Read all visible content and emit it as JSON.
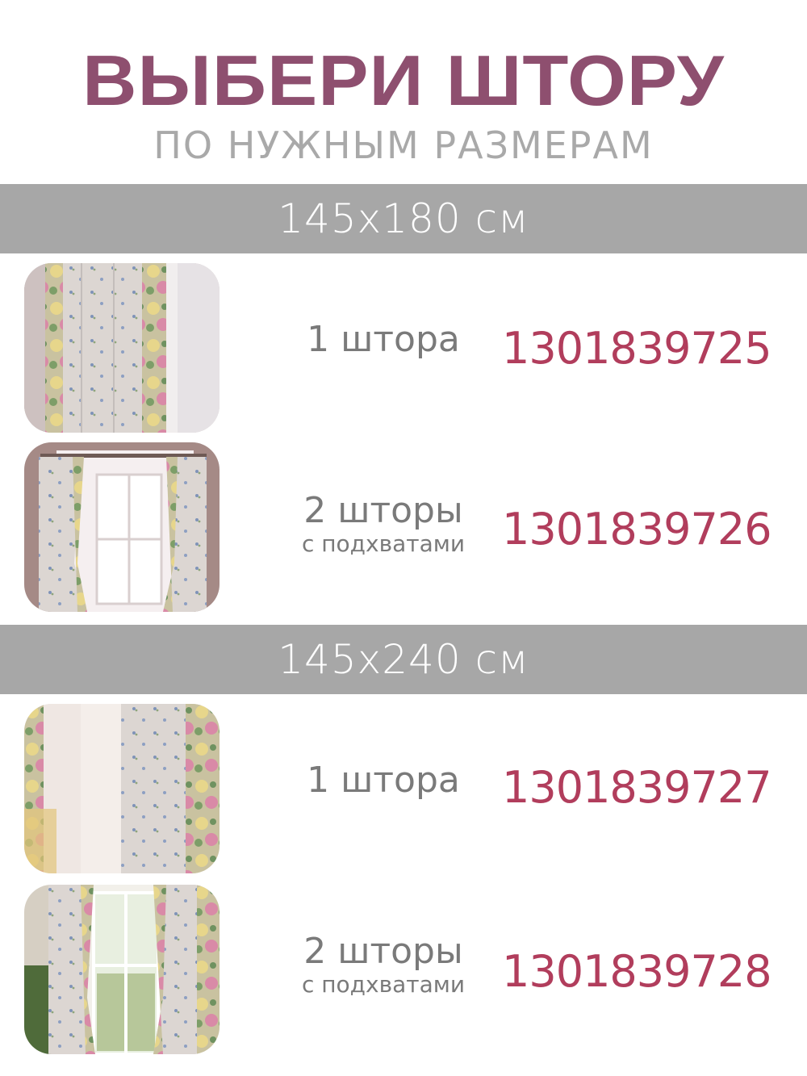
{
  "header": {
    "title": "ВЫБЕРИ ШТОРУ",
    "subtitle": "ПО НУЖНЫМ РАЗМЕРАМ"
  },
  "colors": {
    "title": "#8e4f6f",
    "subtitle": "#a9a9a9",
    "band": "#a7a7a7",
    "code": "#b13d5c",
    "label": "#7a7a7a"
  },
  "sections": [
    {
      "size": "145x180 см",
      "items": [
        {
          "label": "1 штора",
          "sublabel": "",
          "code": "1301839725",
          "icon": "single-curtain-photo"
        },
        {
          "label": "2 шторы",
          "sublabel": "с подхватами",
          "code": "1301839726",
          "icon": "pair-curtains-photo"
        }
      ]
    },
    {
      "size": "145x240 см",
      "items": [
        {
          "label": "1 штора",
          "sublabel": "",
          "code": "1301839727",
          "icon": "single-curtain-photo"
        },
        {
          "label": "2 шторы",
          "sublabel": "с подхватами",
          "code": "1301839728",
          "icon": "pair-curtains-photo"
        }
      ]
    }
  ]
}
